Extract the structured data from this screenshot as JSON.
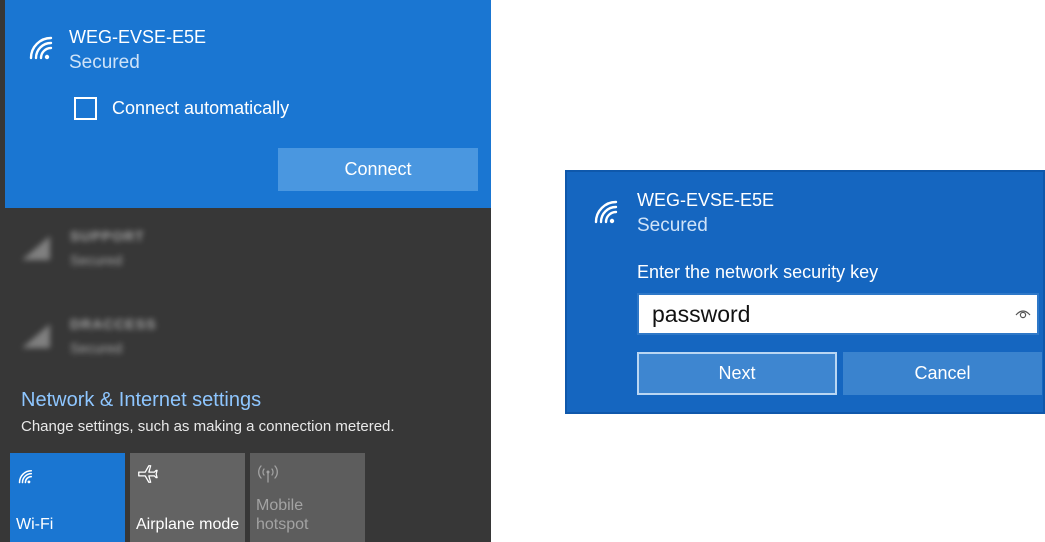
{
  "flyout": {
    "selected_network": {
      "name": "WEG-EVSE-E5E",
      "status": "Secured",
      "connect_automatically_label": "Connect automatically",
      "connect_automatically_checked": false,
      "connect_label": "Connect",
      "icon": "wifi-icon"
    },
    "other_networks": [
      {
        "name": "SUPPORT",
        "status": "Secured",
        "icon": "wifi-icon"
      },
      {
        "name": "DRACCESS",
        "status": "Secured",
        "icon": "wifi-icon"
      }
    ],
    "settings": {
      "title": "Network & Internet settings",
      "description": "Change settings, such as making a connection metered."
    },
    "quick_actions": [
      {
        "label": "Wi-Fi",
        "icon": "wifi-icon",
        "active": true
      },
      {
        "label": "Airplane mode",
        "icon": "airplane-icon",
        "active": false
      },
      {
        "label": "Mobile hotspot",
        "icon": "hotspot-icon",
        "active": false,
        "disabled": true
      }
    ]
  },
  "dialog": {
    "network_name": "WEG-EVSE-E5E",
    "status": "Secured",
    "key_label": "Enter the network security key",
    "password_value": "password",
    "next_label": "Next",
    "cancel_label": "Cancel",
    "reveal_icon": "eye-icon"
  },
  "colors": {
    "accent": "#1a76d2",
    "dialog_bg": "#1566c0",
    "flyout_bg": "#373737",
    "link": "#8ec6ff"
  }
}
